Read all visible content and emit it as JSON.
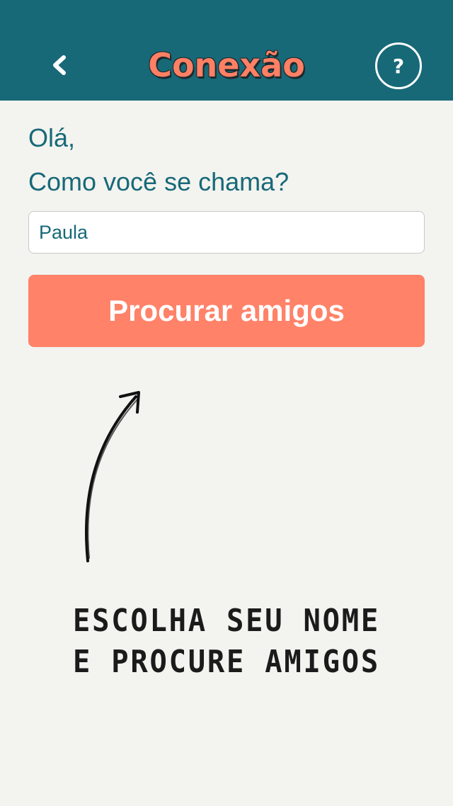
{
  "header": {
    "title": "Conexão",
    "back_icon": "chevron-left-icon",
    "help_label": "?",
    "background_color": "#176978",
    "title_color": "#ff8064"
  },
  "form": {
    "greeting": "Olá,",
    "question": "Como você se chama?",
    "name_value": "Paula",
    "search_button_label": "Procurar amigos",
    "button_color": "#ff8269"
  },
  "hint": {
    "line1": "ESCOLHA SEU NOME",
    "line2": "E PROCURE AMIGOS",
    "arrow_icon": "hand-drawn-arrow-icon"
  }
}
